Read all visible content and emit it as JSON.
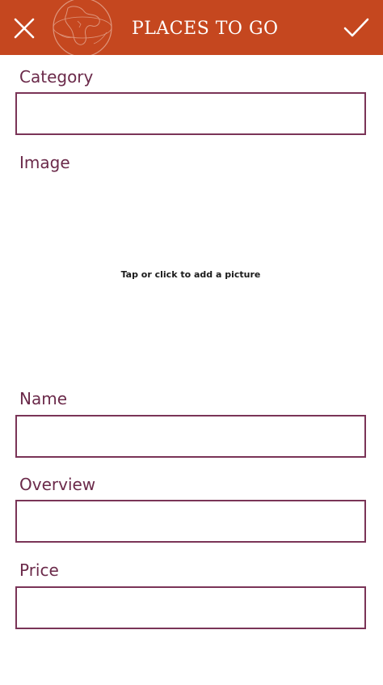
{
  "header": {
    "title": "PLACES TO GO",
    "close_icon": "close-icon",
    "confirm_icon": "checkmark-icon",
    "logo_icon": "globe-icon",
    "background_color": "#c5471f"
  },
  "form": {
    "category": {
      "label": "Category",
      "value": ""
    },
    "image": {
      "label": "Image",
      "hint": "Tap or click to add a picture"
    },
    "name": {
      "label": "Name",
      "value": ""
    },
    "overview": {
      "label": "Overview",
      "value": ""
    },
    "price": {
      "label": "Price",
      "value": ""
    }
  },
  "colors": {
    "label_text": "#6b2a4a",
    "field_border": "#7a3457"
  }
}
